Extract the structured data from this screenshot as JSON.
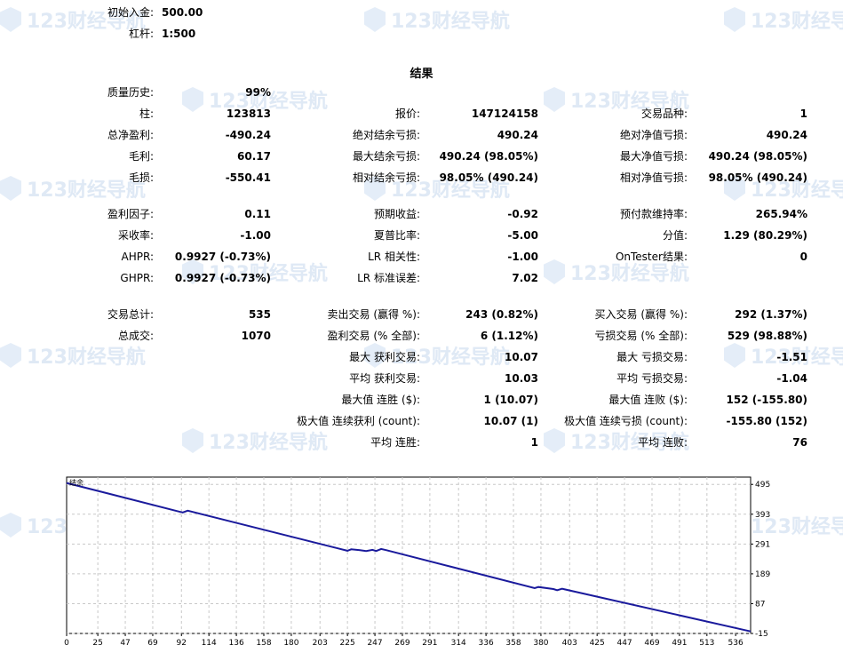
{
  "header": {
    "deposit_label": "初始入金:",
    "deposit_value": "500.00",
    "leverage_label": "杠杆:",
    "leverage_value": "1:500"
  },
  "results_title": "结果",
  "watermark_text": "123财经导航",
  "rows": [
    {
      "y": 104,
      "cells": [
        {
          "col": 0,
          "label": "质量历史:",
          "value": "99%"
        }
      ]
    },
    {
      "y": 128,
      "cells": [
        {
          "col": 0,
          "label": "柱:",
          "value": "123813"
        },
        {
          "col": 1,
          "label": "报价:",
          "value": "147124158"
        },
        {
          "col": 2,
          "label": "交易品种:",
          "value": "1"
        }
      ]
    },
    {
      "y": 152,
      "cells": [
        {
          "col": 0,
          "label": "总净盈利:",
          "value": "-490.24"
        },
        {
          "col": 1,
          "label": "绝对结余亏损:",
          "value": "490.24"
        },
        {
          "col": 2,
          "label": "绝对净值亏损:",
          "value": "490.24"
        }
      ]
    },
    {
      "y": 176,
      "cells": [
        {
          "col": 0,
          "label": "毛利:",
          "value": "60.17"
        },
        {
          "col": 1,
          "label": "最大结余亏损:",
          "value": "490.24 (98.05%)"
        },
        {
          "col": 2,
          "label": "最大净值亏损:",
          "value": "490.24 (98.05%)"
        }
      ]
    },
    {
      "y": 200,
      "cells": [
        {
          "col": 0,
          "label": "毛损:",
          "value": "-550.41"
        },
        {
          "col": 1,
          "label": "相对结余亏损:",
          "value": "98.05% (490.24)"
        },
        {
          "col": 2,
          "label": "相对净值亏损:",
          "value": "98.05% (490.24)"
        }
      ]
    },
    {
      "y": 241,
      "cells": [
        {
          "col": 0,
          "label": "盈利因子:",
          "value": "0.11"
        },
        {
          "col": 1,
          "label": "预期收益:",
          "value": "-0.92"
        },
        {
          "col": 2,
          "label": "预付款维持率:",
          "value": "265.94%"
        }
      ]
    },
    {
      "y": 265,
      "cells": [
        {
          "col": 0,
          "label": "采收率:",
          "value": "-1.00"
        },
        {
          "col": 1,
          "label": "夏普比率:",
          "value": "-5.00"
        },
        {
          "col": 2,
          "label": "分值:",
          "value": "1.29 (80.29%)"
        }
      ]
    },
    {
      "y": 289,
      "cells": [
        {
          "col": 0,
          "label": "AHPR:",
          "value": "0.9927 (-0.73%)"
        },
        {
          "col": 1,
          "label": "LR 相关性:",
          "value": "-1.00"
        },
        {
          "col": 2,
          "label": "OnTester结果:",
          "value": "0"
        }
      ]
    },
    {
      "y": 313,
      "cells": [
        {
          "col": 0,
          "label": "GHPR:",
          "value": "0.9927 (-0.73%)"
        },
        {
          "col": 1,
          "label": "LR 标准误差:",
          "value": "7.02"
        }
      ]
    },
    {
      "y": 354,
      "cells": [
        {
          "col": 0,
          "label": "交易总计:",
          "value": "535"
        },
        {
          "col": 1,
          "label": "卖出交易 (赢得 %):",
          "value": "243 (0.82%)"
        },
        {
          "col": 2,
          "label": "买入交易 (赢得 %):",
          "value": "292 (1.37%)"
        }
      ]
    },
    {
      "y": 378,
      "cells": [
        {
          "col": 0,
          "label": "总成交:",
          "value": "1070"
        },
        {
          "col": 1,
          "label": "盈利交易 (% 全部):",
          "value": "6 (1.12%)"
        },
        {
          "col": 2,
          "label": "亏损交易 (% 全部):",
          "value": "529 (98.88%)"
        }
      ]
    },
    {
      "y": 402,
      "cells": [
        {
          "col": 1,
          "label": "最大 获利交易:",
          "value": "10.07"
        },
        {
          "col": 2,
          "label": "最大 亏损交易:",
          "value": "-1.51"
        }
      ]
    },
    {
      "y": 426,
      "cells": [
        {
          "col": 1,
          "label": "平均 获利交易:",
          "value": "10.03"
        },
        {
          "col": 2,
          "label": "平均 亏损交易:",
          "value": "-1.04"
        }
      ]
    },
    {
      "y": 450,
      "cells": [
        {
          "col": 1,
          "label": "最大值 连胜 ($):",
          "value": "1 (10.07)"
        },
        {
          "col": 2,
          "label": "最大值 连败 ($):",
          "value": "152 (-155.80)"
        }
      ]
    },
    {
      "y": 474,
      "cells": [
        {
          "col": 1,
          "label": "极大值 连续获利 (count):",
          "value": "10.07 (1)"
        },
        {
          "col": 2,
          "label": "极大值 连续亏损 (count):",
          "value": "-155.80 (152)"
        }
      ]
    },
    {
      "y": 498,
      "cells": [
        {
          "col": 1,
          "label": "平均 连胜:",
          "value": "1"
        },
        {
          "col": 2,
          "label": "平均 连败:",
          "value": "76"
        }
      ]
    }
  ],
  "chart_data": {
    "type": "line",
    "title": "",
    "series": [
      {
        "name": "结余",
        "x": [
          0,
          90,
          93,
          97,
          225,
          228,
          235,
          240,
          245,
          248,
          252,
          256,
          375,
          378,
          390,
          393,
          397,
          548
        ],
        "y": [
          500,
          402,
          399,
          405,
          268,
          273,
          270,
          267,
          271,
          267,
          274,
          270,
          140,
          144,
          137,
          133,
          138,
          -8
        ]
      }
    ],
    "x_ticks": [
      0,
      25,
      47,
      69,
      92,
      114,
      136,
      158,
      180,
      203,
      225,
      247,
      269,
      291,
      314,
      336,
      358,
      380,
      403,
      425,
      447,
      469,
      491,
      513,
      536
    ],
    "y_ticks": [
      495,
      393,
      291,
      189,
      87,
      -15
    ],
    "xlim": [
      0,
      548
    ],
    "ylim": [
      -15,
      520
    ],
    "grid": true,
    "line_color": "#1a1a9c"
  }
}
